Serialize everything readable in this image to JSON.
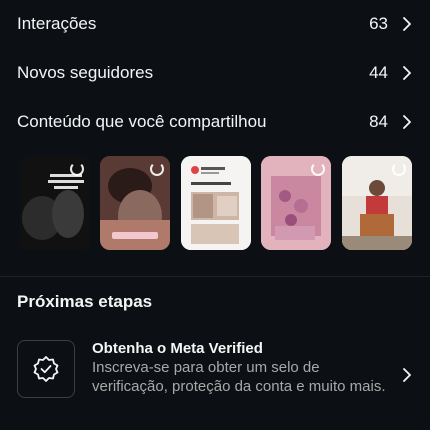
{
  "stats": [
    {
      "label": "Interações",
      "value": "63"
    },
    {
      "label": "Novos seguidores",
      "value": "44"
    },
    {
      "label": "Conteúdo que você compartilhou",
      "value": "84"
    }
  ],
  "thumbnails": {
    "items": [
      {
        "caption": "Que eu falhe com tudo, menos com você",
        "bg": "#1e1e1e"
      },
      {
        "caption": "Emoji Seu... Meu",
        "bg": "#6b4a44"
      },
      {
        "caption": "Meu ano com dinheiro",
        "bg": "#f4f2f1"
      },
      {
        "caption": "",
        "bg": "#d9a5b1"
      },
      {
        "caption": "",
        "bg": "#c9b7a6"
      }
    ]
  },
  "next_steps": {
    "title": "Próximas etapas",
    "card": {
      "title": "Obtenha o Meta Verified",
      "description": "Inscreva-se para obter um selo de verificação, proteção da conta e muito mais.",
      "icon": "verified-badge-icon"
    }
  },
  "colors": {
    "background": "#0c1014",
    "text": "#f5f5f5",
    "secondary_text": "#a8a8a8"
  }
}
